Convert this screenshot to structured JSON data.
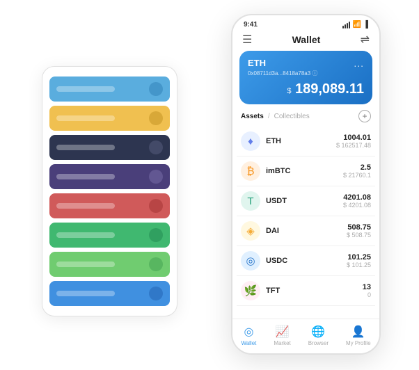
{
  "scene": {
    "background": "#ffffff"
  },
  "card_stack": {
    "items": [
      {
        "color": "#5aadde",
        "dot_color": "#2d7fb5"
      },
      {
        "color": "#f0c050",
        "dot_color": "#c09020"
      },
      {
        "color": "#2d3550",
        "dot_color": "#5a6080"
      },
      {
        "color": "#4a3f7a",
        "dot_color": "#7a6faa"
      },
      {
        "color": "#d05a5a",
        "dot_color": "#a03030"
      },
      {
        "color": "#40b870",
        "dot_color": "#208850"
      },
      {
        "color": "#70cc70",
        "dot_color": "#40a050"
      },
      {
        "color": "#4090e0",
        "dot_color": "#2060b0"
      }
    ]
  },
  "phone": {
    "status_bar": {
      "time": "9:41",
      "signal": "●●●",
      "wifi": "wifi",
      "battery": "battery"
    },
    "header": {
      "menu_icon": "☰",
      "title": "Wallet",
      "expand_icon": "⇌"
    },
    "eth_card": {
      "label": "ETH",
      "address": "0x08711d3a...8418a78a3 ⓘ",
      "dots": "...",
      "balance_symbol": "$",
      "balance": "189,089.11"
    },
    "assets": {
      "tab_active": "Assets",
      "tab_separator": "/",
      "tab_inactive": "Collectibles",
      "add_icon": "+"
    },
    "asset_list": [
      {
        "icon": "♦",
        "icon_bg": "#e8f0ff",
        "icon_color": "#627eea",
        "name": "ETH",
        "amount": "1004.01",
        "usd": "$ 162517.48"
      },
      {
        "icon": "₿",
        "icon_bg": "#fff0e0",
        "icon_color": "#f7931a",
        "name": "imBTC",
        "amount": "2.5",
        "usd": "$ 21760.1"
      },
      {
        "icon": "T",
        "icon_bg": "#e0f5ee",
        "icon_color": "#26a17b",
        "name": "USDT",
        "amount": "4201.08",
        "usd": "$ 4201.08"
      },
      {
        "icon": "◈",
        "icon_bg": "#fff8e0",
        "icon_color": "#f5ac37",
        "name": "DAI",
        "amount": "508.75",
        "usd": "$ 508.75"
      },
      {
        "icon": "◎",
        "icon_bg": "#e0f0ff",
        "icon_color": "#2775ca",
        "name": "USDC",
        "amount": "101.25",
        "usd": "$ 101.25"
      },
      {
        "icon": "🌿",
        "icon_bg": "#ffeef5",
        "icon_color": "#e91e8c",
        "name": "TFT",
        "amount": "13",
        "usd": "0"
      }
    ],
    "bottom_nav": [
      {
        "icon": "◎",
        "label": "Wallet",
        "active": true
      },
      {
        "icon": "📈",
        "label": "Market",
        "active": false
      },
      {
        "icon": "🌐",
        "label": "Browser",
        "active": false
      },
      {
        "icon": "👤",
        "label": "My Profile",
        "active": false
      }
    ]
  }
}
